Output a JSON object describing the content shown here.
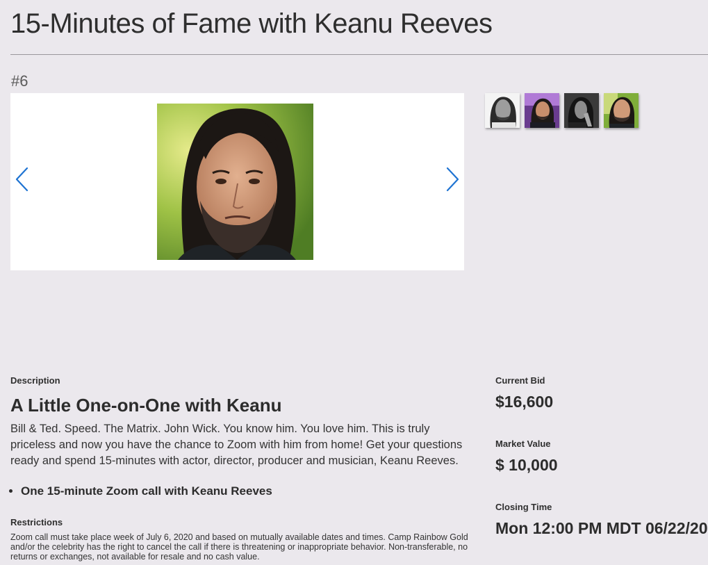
{
  "title": "15-Minutes of Fame with Keanu Reeves",
  "lot_number": "#6",
  "carousel": {
    "prev_icon": "chevron-left-icon",
    "next_icon": "chevron-right-icon",
    "accent": "#1e73d2"
  },
  "thumbnails": [
    {
      "name": "thumbnail-1",
      "style": "grayscale portrait"
    },
    {
      "name": "thumbnail-2",
      "style": "purple background portrait"
    },
    {
      "name": "thumbnail-3",
      "style": "dark grayscale portrait"
    },
    {
      "name": "thumbnail-4",
      "style": "color portrait"
    }
  ],
  "description": {
    "label": "Description",
    "heading": "A Little One-on-One with Keanu",
    "body": "Bill & Ted. Speed. The Matrix. John Wick. You know him. You love him. This is truly priceless and now you have the chance to Zoom with him from home! Get your questions ready and spend 15-minutes with actor, director, producer and musician, Keanu Reeves.",
    "items": [
      "One 15-minute Zoom call with Keanu Reeves"
    ]
  },
  "restrictions": {
    "label": "Restrictions",
    "body": "Zoom call must take place week of July 6, 2020 and based on mutually available dates and times. Camp Rainbow Gold and/or the celebrity has the right to cancel the call if there is threatening or inappropriate behavior. Non-transferable, no returns or exchanges, not available for resale and no cash value."
  },
  "bid": {
    "current_bid_label": "Current Bid",
    "current_bid_value": "$16,600",
    "market_value_label": "Market Value",
    "market_value_value": "$ 10,000",
    "closing_time_label": "Closing Time",
    "closing_time_value": "Mon 12:00 PM MDT 06/22/20"
  },
  "colors": {
    "background": "#ebe8ed",
    "text": "#2c2c2c",
    "arrow": "#1e73d2"
  }
}
